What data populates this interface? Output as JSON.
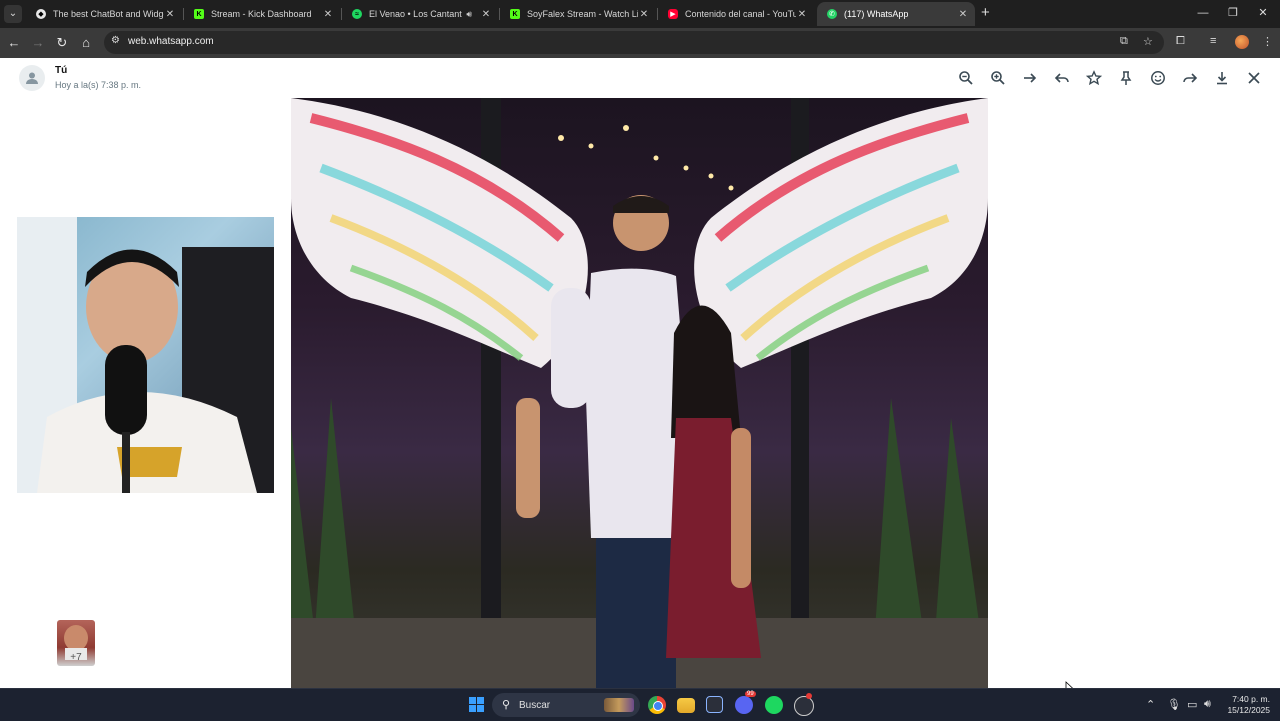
{
  "browser": {
    "tabs": [
      {
        "title": "The best ChatBot and Widgets",
        "favicon": "chatbot-icon",
        "color": "#e8e8e8",
        "active": false,
        "audio": false
      },
      {
        "title": "Stream - Kick Dashboard",
        "favicon": "kick-icon",
        "color": "#53fc18",
        "active": false,
        "audio": false
      },
      {
        "title": "El Venao • Los Cantantes",
        "favicon": "spotify-icon",
        "color": "#1ed760",
        "active": false,
        "audio": true
      },
      {
        "title": "SoyFalex Stream - Watch Live o",
        "favicon": "kick-icon",
        "color": "#53fc18",
        "active": false,
        "audio": false
      },
      {
        "title": "Contenido del canal - YouTube",
        "favicon": "youtube-icon",
        "color": "#ff0033",
        "active": false,
        "audio": false
      },
      {
        "title": "(117) WhatsApp",
        "favicon": "whatsapp-icon",
        "color": "#25d366",
        "active": true,
        "audio": false
      }
    ],
    "url": "web.whatsapp.com"
  },
  "viewer": {
    "sender_name": "Tú",
    "sender_time": "Hoy a la(s) 7:38 p. m.",
    "tools": [
      {
        "name": "zoom-out-button",
        "icon": "zoom-out-icon"
      },
      {
        "name": "zoom-in-button",
        "icon": "zoom-in-icon"
      },
      {
        "name": "go-to-message-button",
        "icon": "arrow-right-icon"
      },
      {
        "name": "reply-button",
        "icon": "reply-icon"
      },
      {
        "name": "star-button",
        "icon": "star-icon"
      },
      {
        "name": "pin-button",
        "icon": "pin-icon"
      },
      {
        "name": "react-button",
        "icon": "emoji-icon"
      },
      {
        "name": "forward-button",
        "icon": "forward-icon"
      },
      {
        "name": "download-button",
        "icon": "download-icon"
      },
      {
        "name": "close-viewer-button",
        "icon": "close-icon"
      }
    ]
  },
  "taskbar": {
    "search_label": "Buscar",
    "clock_time": "7:40 p. m.",
    "clock_date": "15/12/2025",
    "discord_badge": "99"
  }
}
